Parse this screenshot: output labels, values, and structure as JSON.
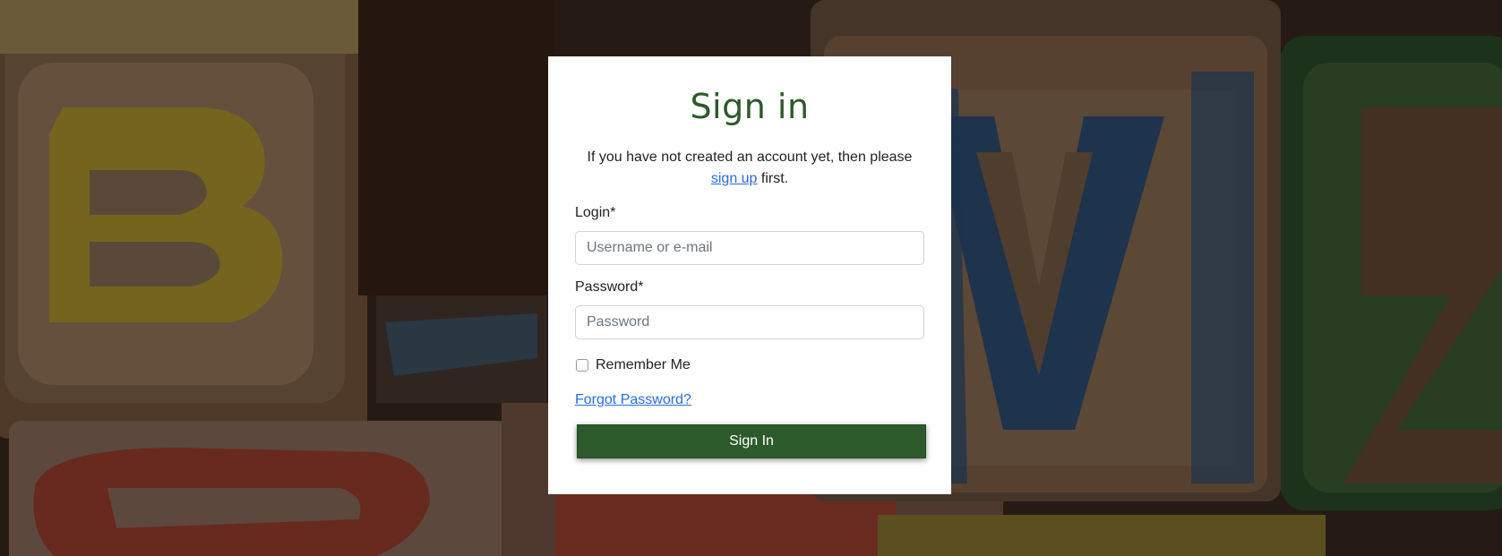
{
  "signin": {
    "title": "Sign in",
    "intro_text": "If you have not created an account yet, then please",
    "signup_link": "sign up",
    "intro_suffix": "first.",
    "login_label": "Login*",
    "login_placeholder": "Username or e-mail",
    "password_label": "Password*",
    "password_placeholder": "Password",
    "remember_label": "Remember Me",
    "remember_checked": false,
    "forgot_link": "Forgot Password?",
    "submit_label": "Sign In"
  },
  "colors": {
    "brand_green": "#2d5a2a",
    "link_blue": "#2a6be0",
    "card_background": "#ffffff"
  }
}
